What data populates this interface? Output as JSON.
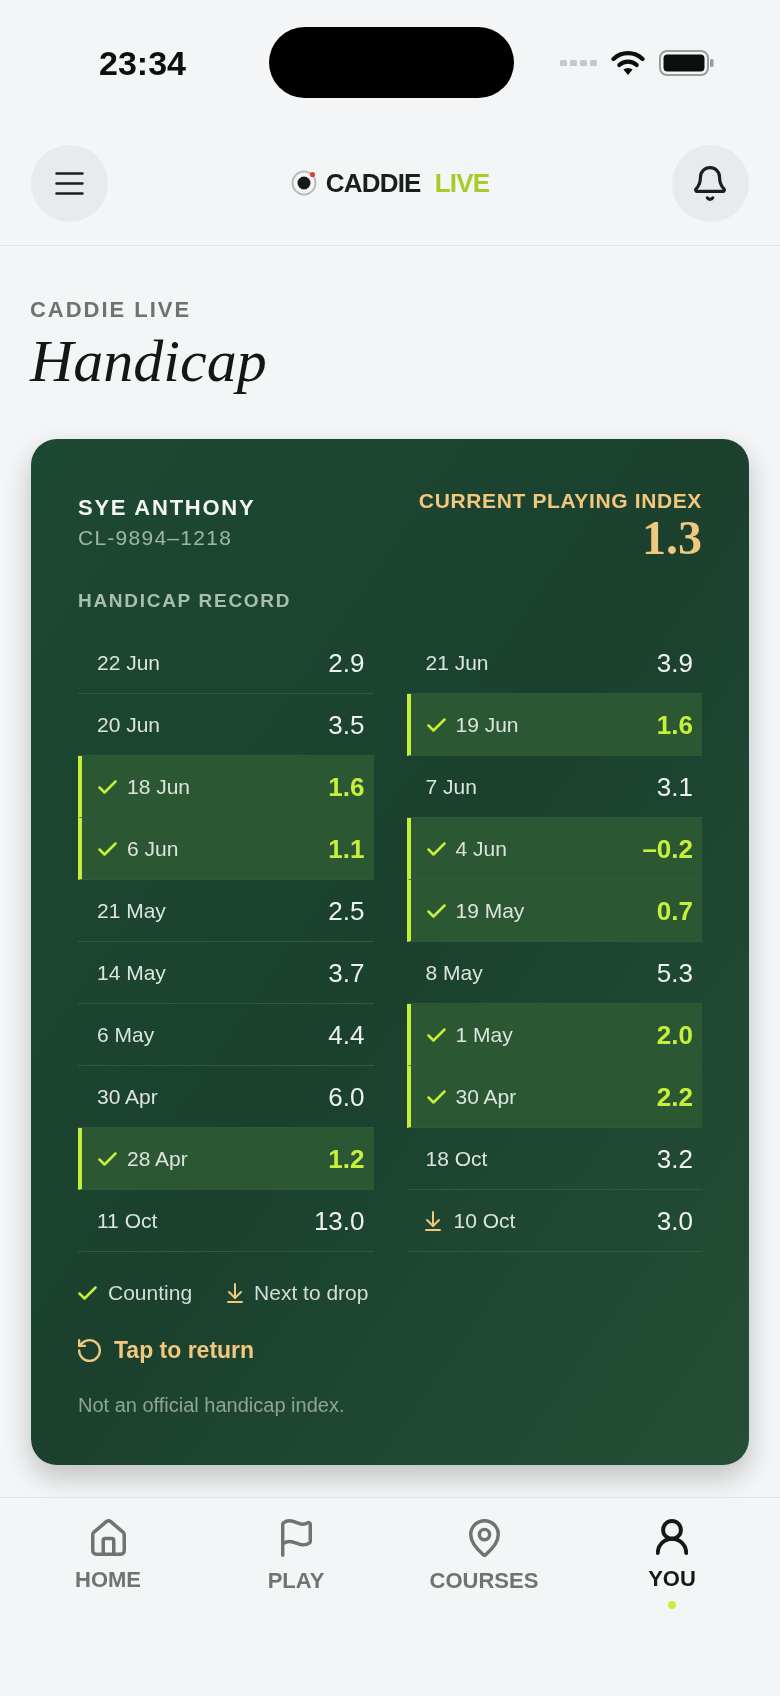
{
  "status_bar": {
    "time": "23:34"
  },
  "header": {
    "logo": {
      "word_1": "CADDIE",
      "word_2": "LIVE"
    }
  },
  "page": {
    "eyebrow": "CADDIE LIVE",
    "title": "Handicap"
  },
  "card": {
    "player_name": "SYE ANTHONY",
    "player_id": "CL-9894–1218",
    "index_label": "CURRENT PLAYING INDEX",
    "index_value": "1.3",
    "record_title": "HANDICAP RECORD",
    "rounds": [
      {
        "date": "22 Jun",
        "value": "2.9",
        "kind": "plain"
      },
      {
        "date": "21 Jun",
        "value": "3.9",
        "kind": "plain"
      },
      {
        "date": "20 Jun",
        "value": "3.5",
        "kind": "plain"
      },
      {
        "date": "19 Jun",
        "value": "1.6",
        "kind": "counting"
      },
      {
        "date": "18 Jun",
        "value": "1.6",
        "kind": "counting"
      },
      {
        "date": "7 Jun",
        "value": "3.1",
        "kind": "plain"
      },
      {
        "date": "6 Jun",
        "value": "1.1",
        "kind": "counting"
      },
      {
        "date": "4 Jun",
        "value": "–0.2",
        "kind": "counting"
      },
      {
        "date": "21 May",
        "value": "2.5",
        "kind": "plain"
      },
      {
        "date": "19 May",
        "value": "0.7",
        "kind": "counting"
      },
      {
        "date": "14 May",
        "value": "3.7",
        "kind": "plain"
      },
      {
        "date": "8 May",
        "value": "5.3",
        "kind": "plain"
      },
      {
        "date": "6 May",
        "value": "4.4",
        "kind": "plain"
      },
      {
        "date": "1 May",
        "value": "2.0",
        "kind": "counting"
      },
      {
        "date": "30 Apr",
        "value": "6.0",
        "kind": "plain"
      },
      {
        "date": "30 Apr",
        "value": "2.2",
        "kind": "counting"
      },
      {
        "date": "28 Apr",
        "value": "1.2",
        "kind": "counting"
      },
      {
        "date": "18 Oct",
        "value": "3.2",
        "kind": "plain"
      },
      {
        "date": "11 Oct",
        "value": "13.0",
        "kind": "plain"
      },
      {
        "date": "10 Oct",
        "value": "3.0",
        "kind": "next_to_drop"
      }
    ],
    "legend": [
      {
        "kind": "counting",
        "label": "Counting"
      },
      {
        "kind": "next_to_drop",
        "label": "Next to drop"
      }
    ],
    "return_action": "Tap to return",
    "disclaimer": "Not an official handicap index."
  },
  "nav": [
    {
      "label": "HOME",
      "selected": false
    },
    {
      "label": "PLAY",
      "selected": false
    },
    {
      "label": "COURSES",
      "selected": false
    },
    {
      "label": "YOU",
      "selected": true
    }
  ]
}
